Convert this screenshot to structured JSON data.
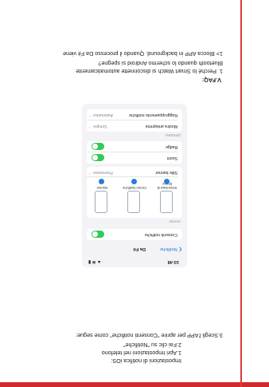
{
  "colors": {
    "accent": "#cf2b2b",
    "toggle_on": "#34c759",
    "link": "#2a7bd6"
  },
  "article": {
    "heading": "Impostazioni di notifica iOS:",
    "steps": [
      "1.Apri Impostazioni nel telefono",
      "2.Fai clic su \"Notifiche\"",
      "3.Scegli l'APP per aprire \"Consenti notifiche\" come segue:"
    ],
    "faq_title": "Ⅴ.FAQ:",
    "faq_q1_line1": "1. Perché lo Smart Watch si disconnette automaticamente",
    "faq_q1_line2": "Bluetooth quando lo schermo Android si spegne?",
    "faq_a1": "1> Blocca APP in background. Quando il processo Da Fit viene"
  },
  "phone": {
    "time": "10:48",
    "status_icons": "▲ ≋ ▮",
    "back_label": "Notifiche",
    "title": "Da Fit",
    "allow_notifications": "Consenti notifiche",
    "alerts_header": "AVVISI",
    "alert_styles": [
      {
        "label": "Schermata di blocco",
        "icon": "lock-screen-preview-icon"
      },
      {
        "label": "Centro Notifiche",
        "icon": "notification-center-preview-icon"
      },
      {
        "label": "Banner",
        "icon": "banner-preview-icon"
      }
    ],
    "banner_style_label": "Stile banner",
    "banner_style_value": "Provvisorio",
    "sounds_label": "Suoni",
    "badge_label": "Badge",
    "options_header": "OPZIONI",
    "show_previews_label": "Mostra anteprime",
    "show_previews_value": "Sempre",
    "grouping_label": "Raggruppamento notifiche",
    "grouping_value": "Automatico"
  }
}
